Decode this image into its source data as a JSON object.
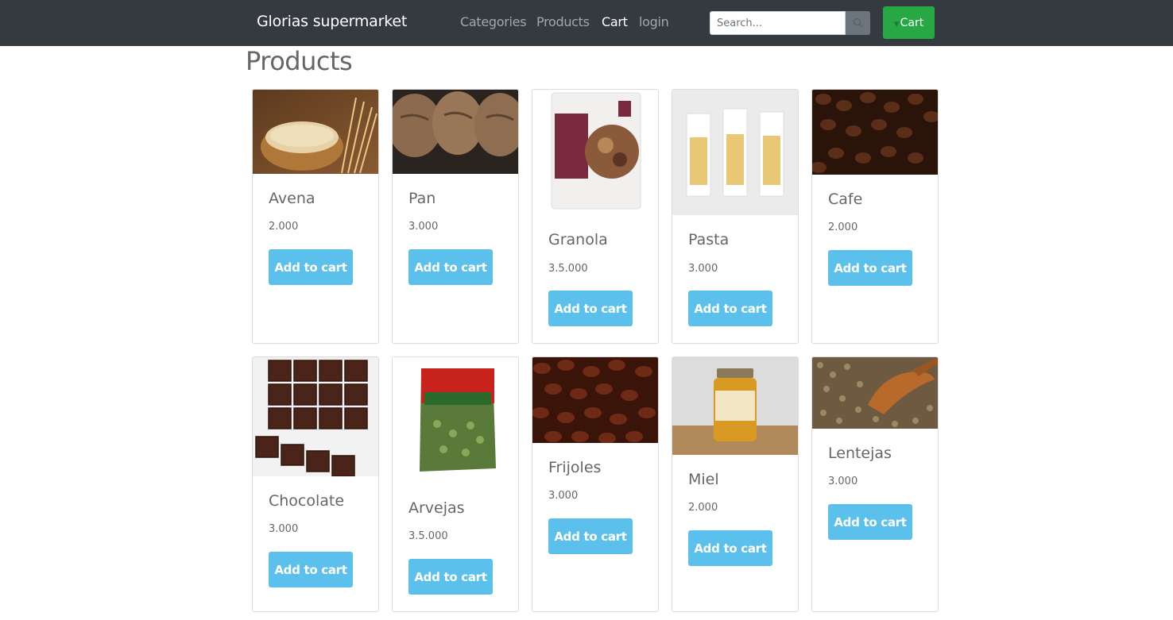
{
  "navbar": {
    "brand": "Glorias supermarket",
    "links": [
      "Categories",
      "Products",
      "Cart",
      "login"
    ],
    "search_placeholder": "Search...",
    "cart_button": "Cart"
  },
  "page_title": "Products",
  "add_label": "Add to cart",
  "products": [
    {
      "name": "Avena",
      "price": "2.000"
    },
    {
      "name": "Pan",
      "price": "3.000"
    },
    {
      "name": "Granola",
      "price": "3.5.000"
    },
    {
      "name": "Pasta",
      "price": "3.000"
    },
    {
      "name": "Cafe",
      "price": "2.000"
    },
    {
      "name": "Chocolate",
      "price": "3.000"
    },
    {
      "name": "Arvejas",
      "price": "3.5.000"
    },
    {
      "name": "Frijoles",
      "price": "3.000"
    },
    {
      "name": "Miel",
      "price": "2.000"
    },
    {
      "name": "Lentejas",
      "price": "3.000"
    }
  ],
  "colors": {
    "navbar": "#343a40",
    "cart_button": "#28a745",
    "add_button": "#5bc0eb"
  }
}
